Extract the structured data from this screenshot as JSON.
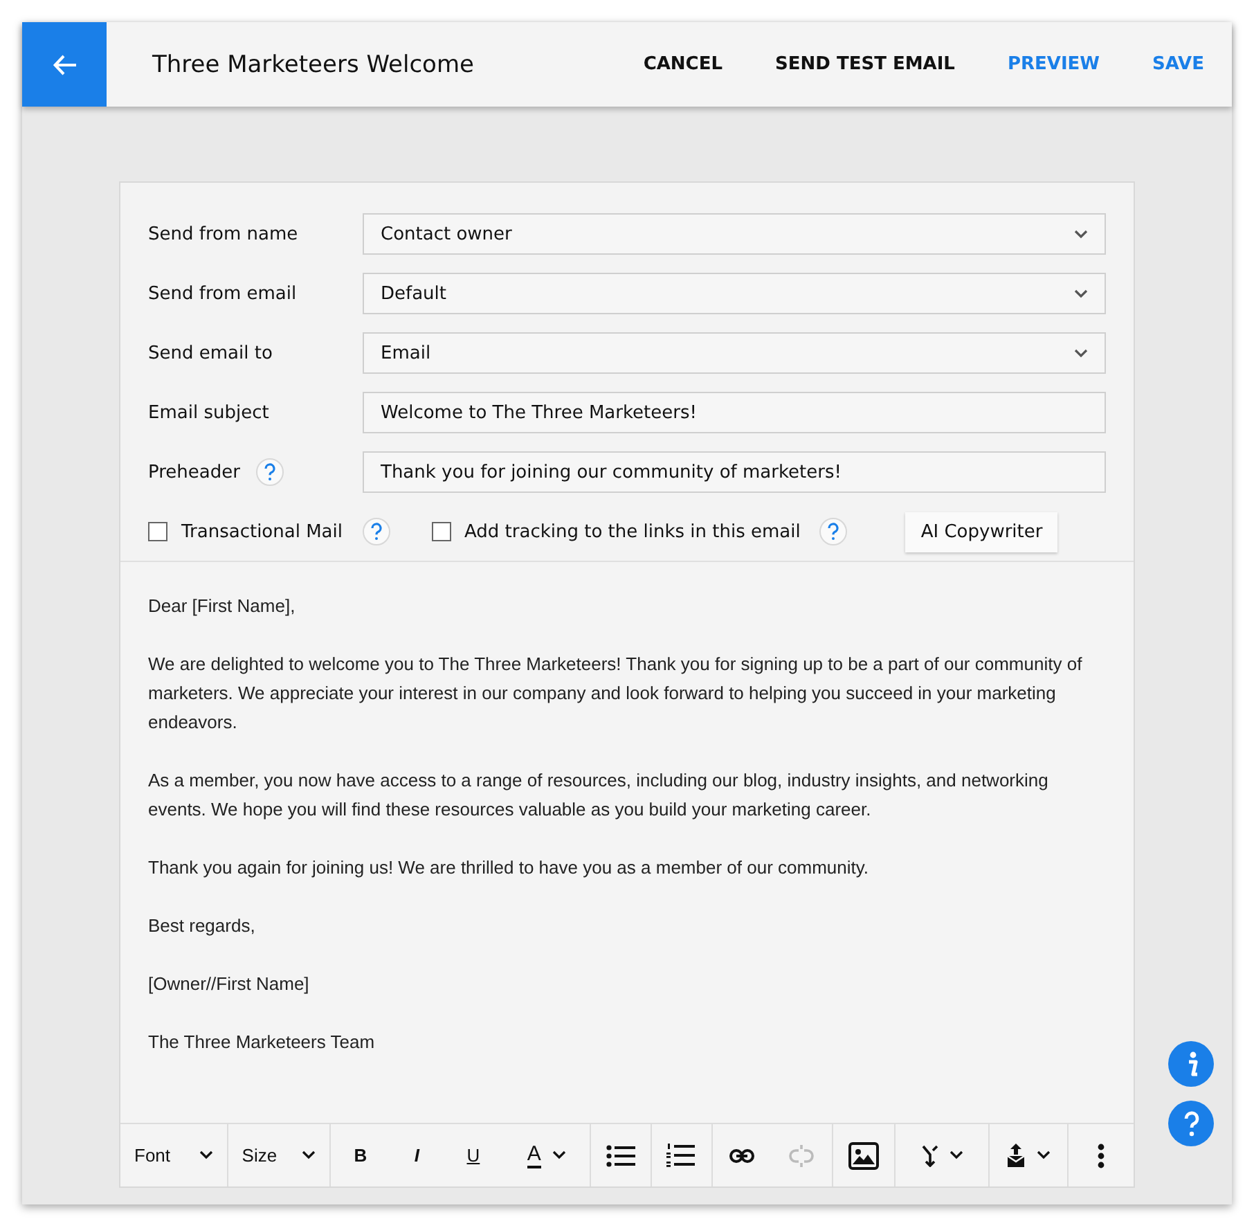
{
  "header": {
    "title": "Three Marketeers Welcome",
    "actions": [
      {
        "label": "CANCEL",
        "color": "#111111"
      },
      {
        "label": "SEND TEST EMAIL",
        "color": "#111111"
      },
      {
        "label": "PREVIEW",
        "color": "#1a7fe8"
      },
      {
        "label": "SAVE",
        "color": "#1a7fe8"
      }
    ]
  },
  "form": {
    "fields": [
      {
        "label": "Send from name",
        "kind": "select",
        "value": "Contact owner",
        "help": false
      },
      {
        "label": "Send from email",
        "kind": "select",
        "value": "Default",
        "help": false
      },
      {
        "label": "Send email to",
        "kind": "select",
        "value": "Email",
        "help": false
      },
      {
        "label": "Email subject",
        "kind": "text",
        "value": "Welcome to The Three Marketeers!",
        "help": false
      },
      {
        "label": "Preheader",
        "kind": "text",
        "value": "Thank you for joining our community of marketers!",
        "help": true
      }
    ],
    "options": [
      {
        "label": "Transactional Mail",
        "checked": false
      },
      {
        "label": "Add tracking to the links in this email",
        "checked": false
      }
    ],
    "ai_button": "AI Copywriter"
  },
  "body": [
    "Dear [First Name],",
    "We are delighted to welcome you to The Three Marketeers! Thank you for signing up to be a part of our community of marketers. We appreciate your interest in our company and look forward to helping you succeed in your marketing endeavors.",
    "As a member, you now have access to a range of resources, including our blog, industry insights, and networking events. We hope you will find these resources valuable as you build your marketing career.",
    "Thank you again for joining us! We are thrilled to have you as a member of our community.",
    "Best regards,",
    "[Owner//First Name]",
    "The Three Marketeers Team"
  ],
  "toolbar": [
    [
      {
        "kind": "select",
        "label": "Font",
        "disabled": false
      }
    ],
    [
      {
        "kind": "select",
        "label": "Size",
        "disabled": false
      }
    ],
    [
      {
        "kind": "bold",
        "label": "B",
        "disabled": false
      },
      {
        "kind": "italic",
        "label": "I",
        "disabled": false
      },
      {
        "kind": "underline",
        "label": "U",
        "disabled": false
      },
      {
        "kind": "color",
        "label": "A",
        "disabled": false
      }
    ],
    [
      {
        "kind": "bullet-list",
        "disabled": false
      }
    ],
    [
      {
        "kind": "numbered-list",
        "disabled": false
      }
    ],
    [
      {
        "kind": "link",
        "disabled": false
      },
      {
        "kind": "unlink",
        "disabled": true
      }
    ],
    [
      {
        "kind": "image",
        "disabled": false
      }
    ],
    [
      {
        "kind": "merge",
        "disabled": false
      }
    ],
    [
      {
        "kind": "insert",
        "disabled": false
      }
    ],
    [
      {
        "kind": "more",
        "disabled": false
      }
    ]
  ]
}
